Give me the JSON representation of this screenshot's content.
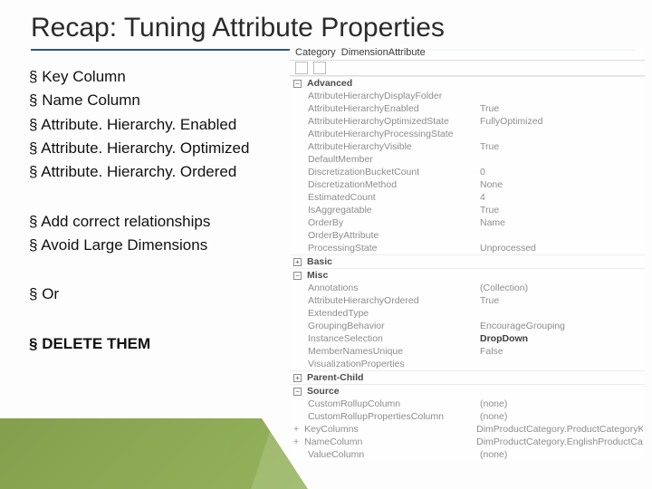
{
  "title": "Recap: Tuning Attribute Properties",
  "bullets": {
    "group1": [
      "Key Column",
      "Name Column",
      "Attribute. Hierarchy. Enabled",
      "Attribute. Hierarchy. Optimized",
      "Attribute. Hierarchy. Ordered"
    ],
    "group2": [
      "Add correct relationships",
      "Avoid Large  Dimensions"
    ],
    "group3": [
      "Or"
    ],
    "group4": [
      "DELETE THEM"
    ]
  },
  "props": {
    "header_label": "Category",
    "header_value": "DimensionAttribute",
    "groups": [
      {
        "name": "Advanced",
        "expanded": true,
        "rows": [
          {
            "k": "AttributeHierarchyDisplayFolder",
            "v": ""
          },
          {
            "k": "AttributeHierarchyEnabled",
            "v": "True"
          },
          {
            "k": "AttributeHierarchyOptimizedState",
            "v": "FullyOptimized"
          },
          {
            "k": "AttributeHierarchyProcessingState",
            "v": ""
          },
          {
            "k": "AttributeHierarchyVisible",
            "v": "True"
          },
          {
            "k": "DefaultMember",
            "v": ""
          },
          {
            "k": "DiscretizationBucketCount",
            "v": "0"
          },
          {
            "k": "DiscretizationMethod",
            "v": "None"
          },
          {
            "k": "EstimatedCount",
            "v": "4"
          },
          {
            "k": "IsAggregatable",
            "v": "True"
          },
          {
            "k": "OrderBy",
            "v": "Name"
          },
          {
            "k": "OrderByAttribute",
            "v": ""
          },
          {
            "k": "ProcessingState",
            "v": "Unprocessed"
          }
        ]
      },
      {
        "name": "Basic",
        "expanded": false,
        "rows": []
      },
      {
        "name": "Misc",
        "expanded": true,
        "rows": [
          {
            "k": "Annotations",
            "v": "(Collection)"
          },
          {
            "k": "AttributeHierarchyOrdered",
            "v": "True"
          },
          {
            "k": "ExtendedType",
            "v": ""
          },
          {
            "k": "GroupingBehavior",
            "v": "EncourageGrouping"
          },
          {
            "k": "InstanceSelection",
            "v": "DropDown",
            "strong": true
          },
          {
            "k": "MemberNamesUnique",
            "v": "False"
          },
          {
            "k": "VisualizationProperties",
            "v": "",
            "faint": true
          }
        ]
      },
      {
        "name": "Parent-Child",
        "expanded": false,
        "rows": []
      },
      {
        "name": "Source",
        "expanded": true,
        "rows": [
          {
            "k": "CustomRollupColumn",
            "v": "(none)"
          },
          {
            "k": "CustomRollupPropertiesColumn",
            "v": "(none)"
          },
          {
            "k": "KeyColumns",
            "v": "DimProductCategory.ProductCategoryKey (Intege",
            "sub": true
          },
          {
            "k": "NameColumn",
            "v": "DimProductCategory.EnglishProductCategoryNa",
            "sub": true
          },
          {
            "k": "ValueColumn",
            "v": "(none)"
          }
        ]
      }
    ]
  }
}
